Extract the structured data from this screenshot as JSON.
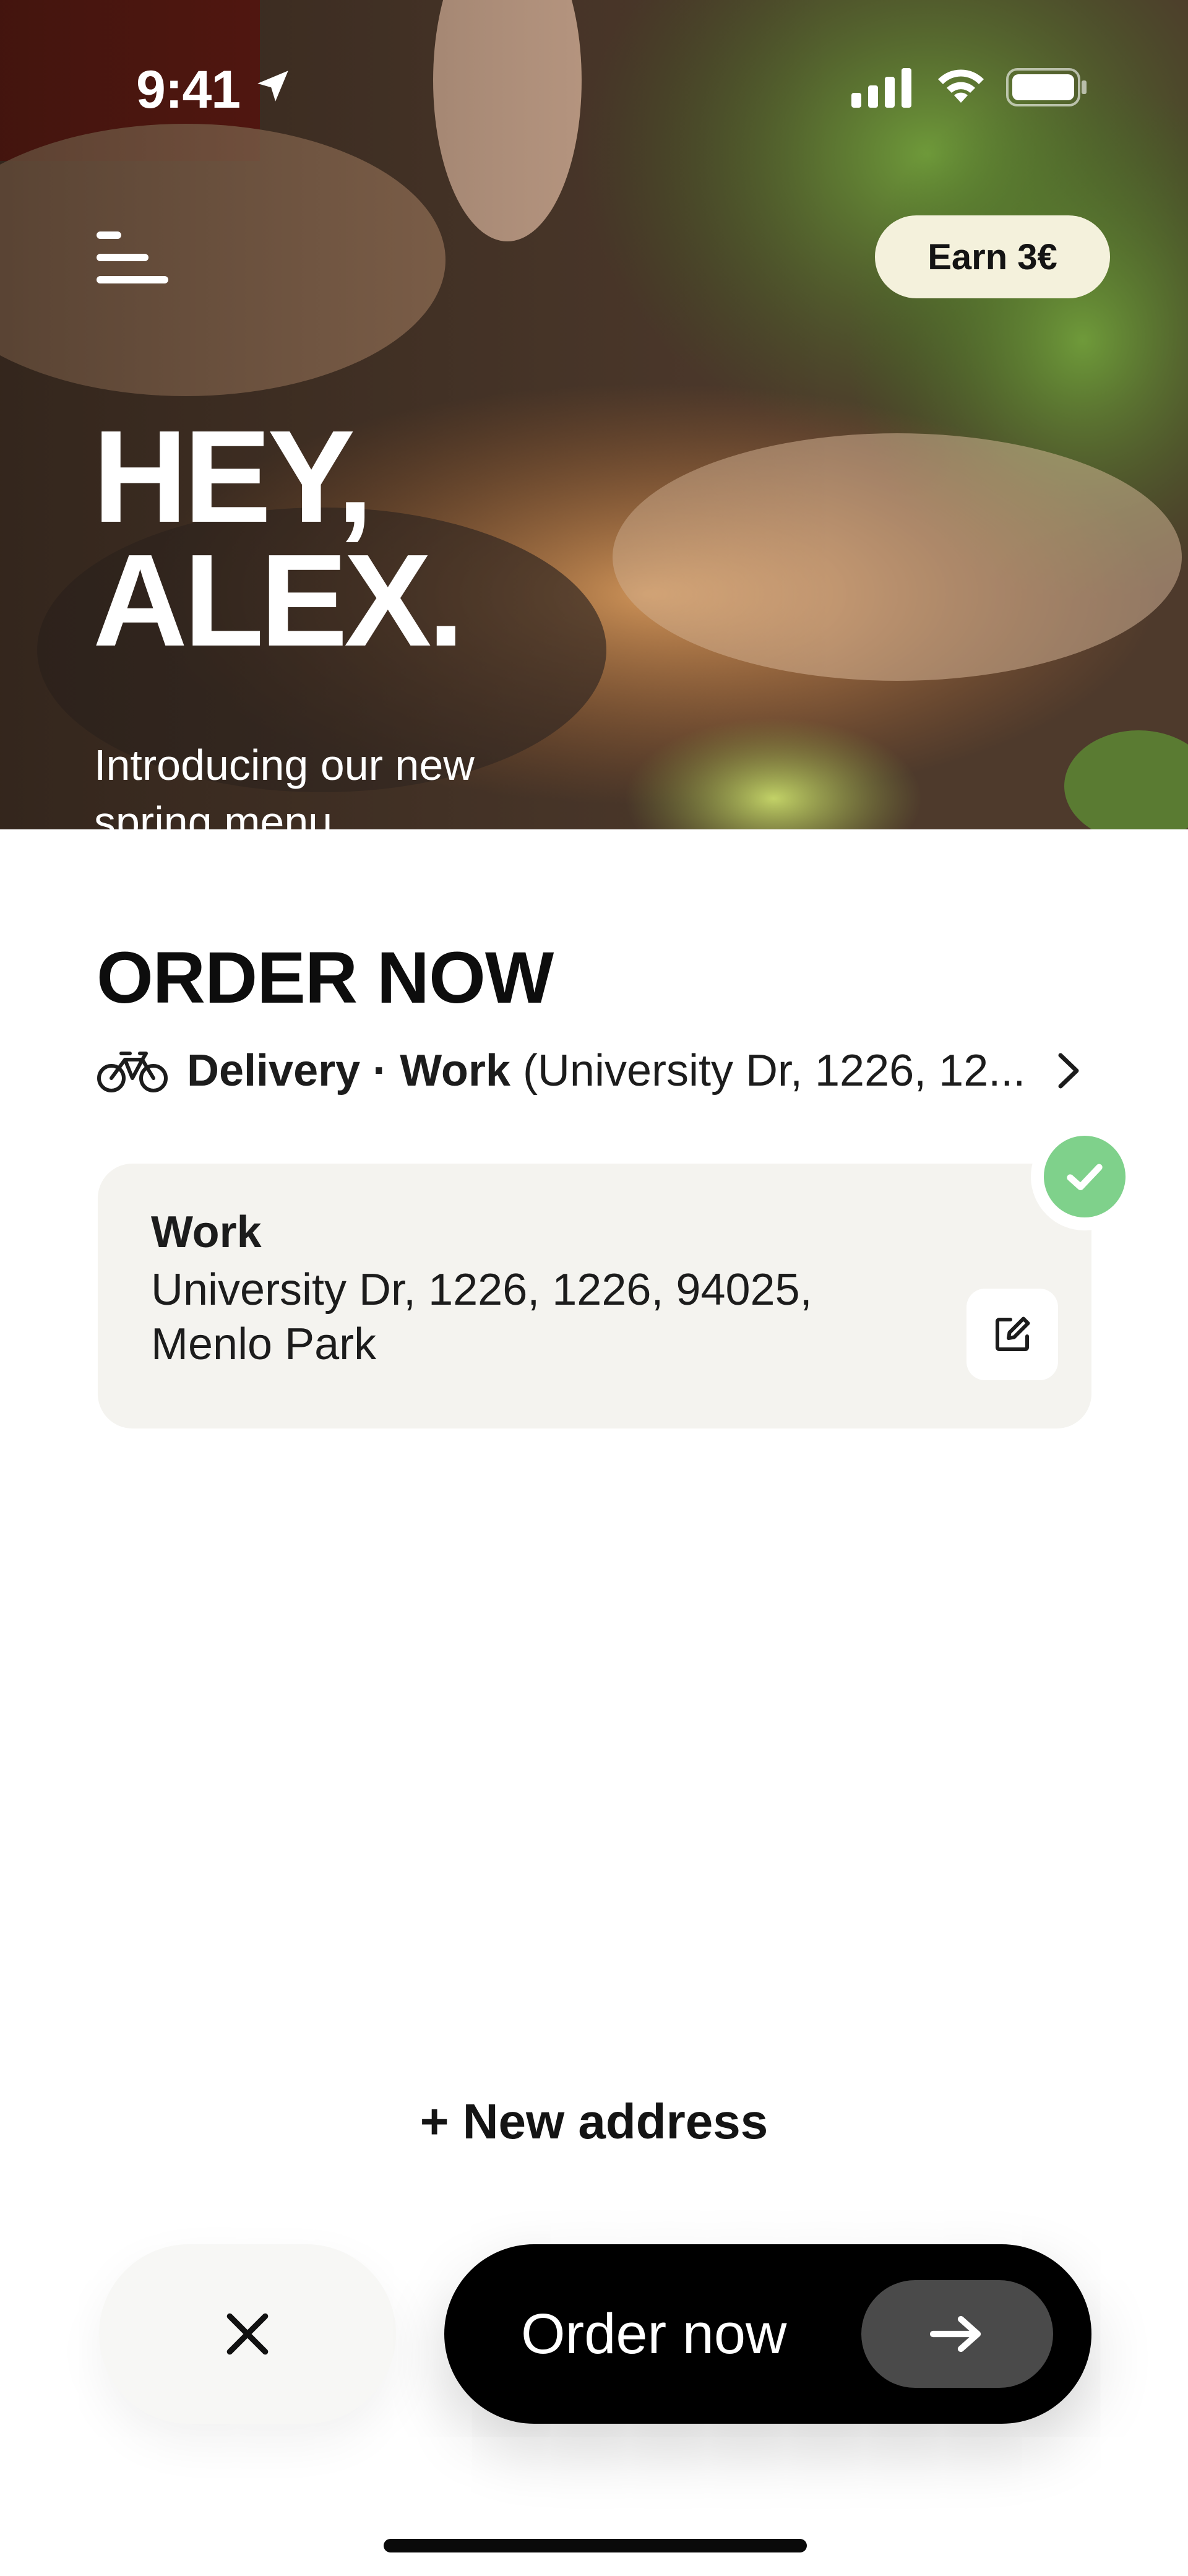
{
  "status_bar": {
    "time": "9:41"
  },
  "hero": {
    "earn_label": "Earn 3€",
    "greeting_line1": "HEY,",
    "greeting_line2": "ALEX.",
    "subtitle": "Introducing our new spring menu"
  },
  "order": {
    "title": "ORDER NOW",
    "mode": "Delivery",
    "separator": "·",
    "location_name": "Work",
    "location_summary": "(University Dr, 1226, 12..."
  },
  "address_card": {
    "name": "Work",
    "line": "University Dr, 1226, 1226, 94025, Menlo Park",
    "selected": true
  },
  "new_address_label": "+ New address",
  "bottom_bar": {
    "order_label": "Order now"
  },
  "colors": {
    "accent_badge": "#f4f1dc",
    "check_green": "#7fd18b",
    "card_bg": "#f4f3ef",
    "cta_bg": "#000000"
  },
  "icons": {
    "menu": "hamburger-menu-icon",
    "location": "location-arrow-icon",
    "bike": "bicycle-icon",
    "chevron": "chevron-right-icon",
    "edit": "edit-icon",
    "check": "check-icon",
    "close": "close-icon",
    "arrow": "arrow-right-icon"
  }
}
